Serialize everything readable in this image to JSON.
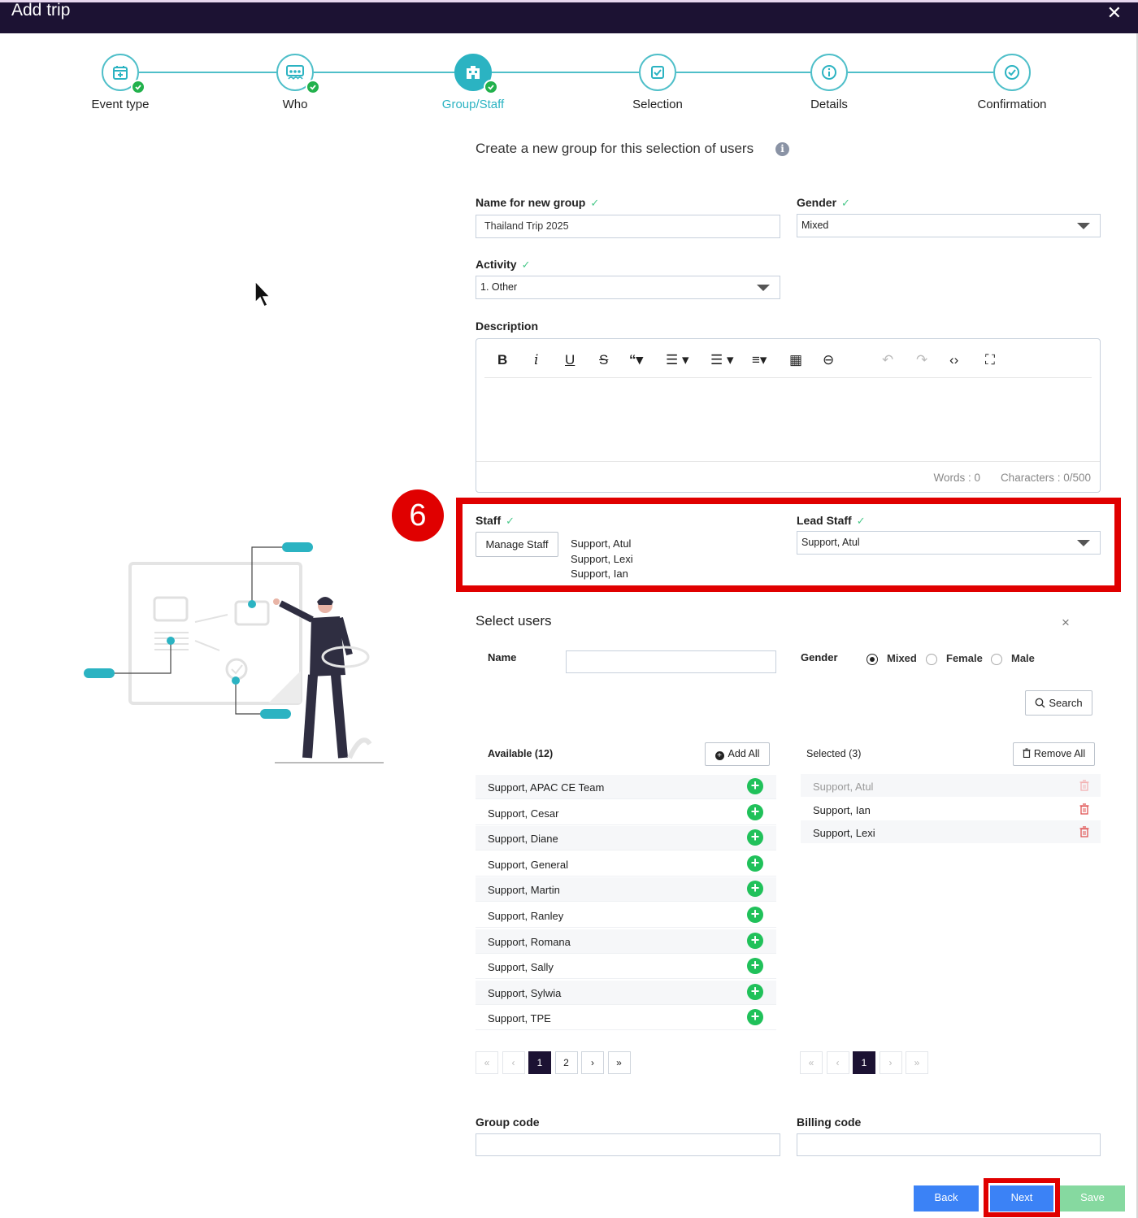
{
  "window": {
    "title": "Add trip",
    "close": "✕"
  },
  "steps": [
    {
      "label": "Event type",
      "icon": "calendar-plus-icon",
      "done": true
    },
    {
      "label": "Who",
      "icon": "group-icon",
      "done": true
    },
    {
      "label": "Group/Staff",
      "icon": "building-icon",
      "done": true,
      "active": true
    },
    {
      "label": "Selection",
      "icon": "checkbox-icon",
      "done": false
    },
    {
      "label": "Details",
      "icon": "info-icon",
      "done": false
    },
    {
      "label": "Confirmation",
      "icon": "check-circle-icon",
      "done": false
    }
  ],
  "form": {
    "heading": "Create a new group for this selection of users",
    "info_glyph": "i",
    "tick": "✓",
    "name_label": "Name for new group",
    "name_value": "Thailand Trip 2025",
    "gender_label": "Gender",
    "gender_value": "Mixed",
    "activity_label": "Activity",
    "activity_value": "1. Other",
    "description_label": "Description",
    "words": "Words : 0",
    "characters": "Characters : 0/500",
    "staff_label": "Staff",
    "manage_staff": "Manage Staff",
    "staff_list": [
      "Support, Atul",
      "Support, Lexi",
      "Support, Ian"
    ],
    "lead_staff_label": "Lead Staff",
    "lead_staff_value": "Support, Atul",
    "group_code_label": "Group code",
    "billing_code_label": "Billing code"
  },
  "annotation": {
    "step_number": "6",
    "color": "#e00000"
  },
  "select_users": {
    "title": "Select users",
    "close": "×",
    "name_label": "Name",
    "gender_label": "Gender",
    "gender_options": [
      "Mixed",
      "Female",
      "Male"
    ],
    "gender_selected": "Mixed",
    "search": "Search",
    "available_label": "Available (12)",
    "add_all": "Add All",
    "selected_label": "Selected (3)",
    "remove_all": "Remove All",
    "available": [
      "Support, APAC CE Team",
      "Support, Cesar",
      "Support, Diane",
      "Support, General",
      "Support, Martin",
      "Support, Ranley",
      "Support, Romana",
      "Support, Sally",
      "Support, Sylwia",
      "Support, TPE"
    ],
    "selected": [
      {
        "name": "Support, Atul",
        "disabled": true
      },
      {
        "name": "Support, Ian",
        "disabled": false
      },
      {
        "name": "Support, Lexi",
        "disabled": false
      }
    ],
    "pager_left": [
      "«",
      "‹",
      "1",
      "2",
      "›",
      "»"
    ],
    "pager_right": [
      "«",
      "‹",
      "1",
      "›",
      "»"
    ]
  },
  "footer": {
    "back": "Back",
    "next": "Next",
    "save": "Save"
  },
  "colors": {
    "accent": "#2bb3c2",
    "header": "#1c1233",
    "success": "#20c15a",
    "primary": "#3b82f6",
    "save": "#86d9a0"
  }
}
